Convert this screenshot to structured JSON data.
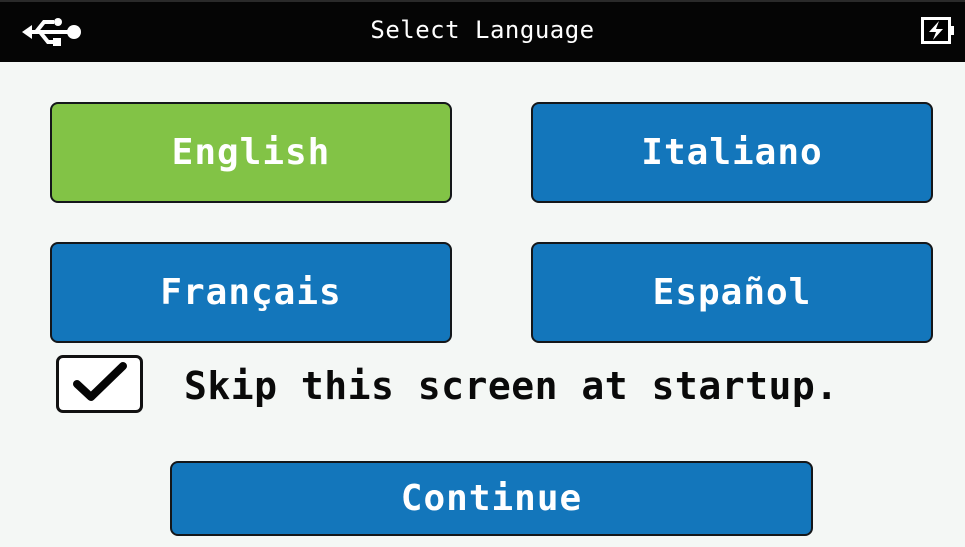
{
  "header": {
    "title": "Select Language",
    "left_icon": "usb-icon",
    "right_icon": "battery-charging-icon"
  },
  "languages": [
    {
      "label": "English",
      "selected": true
    },
    {
      "label": "Italiano",
      "selected": false
    },
    {
      "label": "Français",
      "selected": false
    },
    {
      "label": "Español",
      "selected": false
    }
  ],
  "skip": {
    "label": "Skip this screen at startup.",
    "checked": true
  },
  "continue_label": "Continue",
  "colors": {
    "header_bg": "#050505",
    "button_blue": "#1376bb",
    "button_selected": "#82c346",
    "page_bg": "#f4f7f5"
  }
}
